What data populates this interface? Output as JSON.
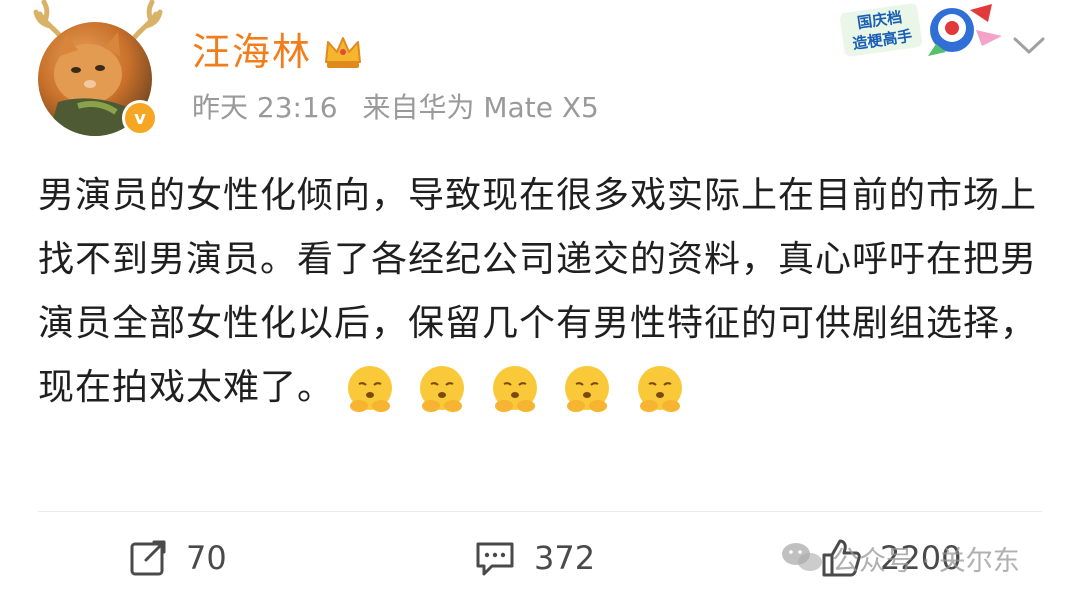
{
  "user": {
    "name": "汪海林",
    "verified_mark": "v",
    "icons": [
      "crown-icon",
      "verified-badge-icon"
    ]
  },
  "meta": {
    "time": "昨天 23:16",
    "source": "来自华为 Mate X5"
  },
  "badge": {
    "line1": "国庆档",
    "line2": "造梗高手"
  },
  "post": {
    "text": "男演员的女性化倾向，导致现在很多戏实际上在目前的市场上找不到男演员。看了各经纪公司递交的资料，真心呼吁在把男演员全部女性化以后，保留几个有男性特征的可供剧组选择，现在拍戏太难了。",
    "emoji_count": 5,
    "emoji_name": "pleading-face-emoji"
  },
  "actions": {
    "repost_count": "70",
    "comment_count": "372",
    "like_count": "2200"
  },
  "watermark": {
    "text": "公众号 · 关尔东"
  },
  "colors": {
    "username": "#f07e1d",
    "meta": "#9a9a9a",
    "text": "#1f1f1f",
    "verified": "#f5a623",
    "action": "#4a4a4a"
  }
}
